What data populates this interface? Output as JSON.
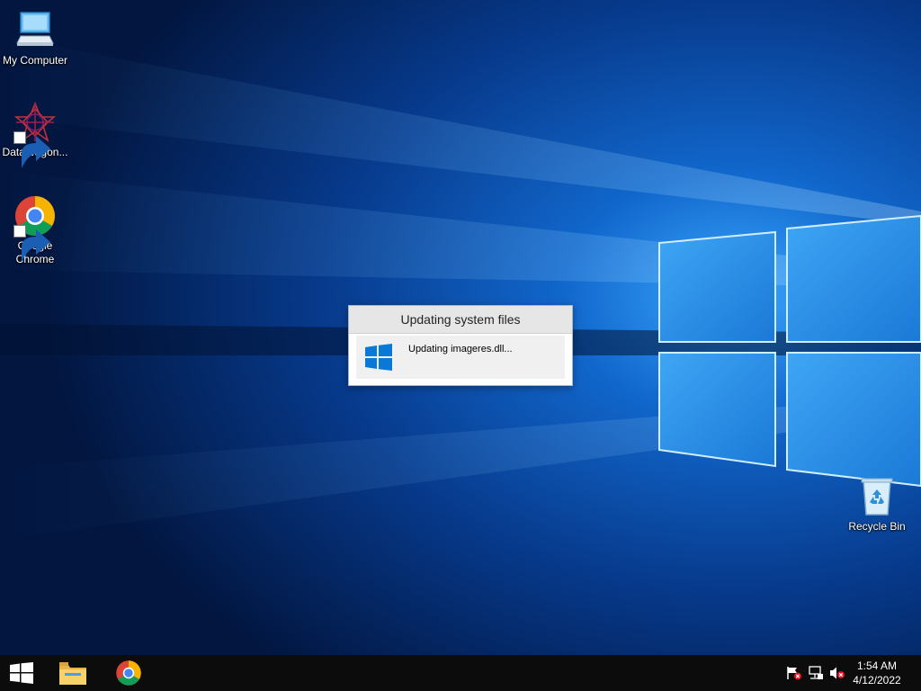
{
  "desktop": {
    "icons": [
      {
        "label": "My Computer"
      },
      {
        "label": "DataWagon..."
      },
      {
        "label": "Google Chrome"
      },
      {
        "label": "Recycle Bin"
      }
    ]
  },
  "dialog": {
    "title": "Updating system files",
    "message": "Updating imageres.dll..."
  },
  "taskbar": {
    "start_icon": "windows-logo-icon",
    "pinned": [
      "file-explorer-icon",
      "chrome-icon"
    ],
    "tray_icons": [
      "action-center-flag-icon",
      "network-icon",
      "volume-muted-icon"
    ],
    "time": "1:54 AM",
    "date": "4/12/2022"
  },
  "colors": {
    "wallpaper_dark": "#021a4a",
    "wallpaper_light": "#2a8fe8",
    "taskbar": "#0c0c0c",
    "windows_blue": "#0a78d7"
  }
}
